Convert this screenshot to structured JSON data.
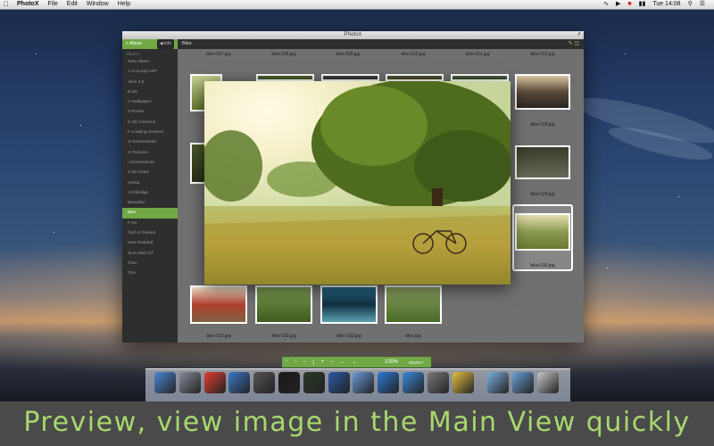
{
  "menubar": {
    "app": "PhotoX",
    "items": [
      "File",
      "Edit",
      "Window",
      "Help"
    ],
    "clock": "Tue 14:08"
  },
  "window": {
    "title": "PhotoX"
  },
  "sidebar": {
    "album_label": "+ Album",
    "info_label": "info",
    "caption": "Albums",
    "items": [
      "New Album",
      "A-Concept ART",
      "Alive 4.0",
      "B-3D",
      "C-Wallpaper",
      "D-Poster",
      "E-3D Columns",
      "F-Loading Screens",
      "G-Screenshots",
      "H-Textures",
      "I-Screenshots",
      "J-3D Chars",
      "Aprilia",
      "Archbridge",
      "Beautiful",
      "Bike",
      "F-16",
      "Golf of Finland",
      "New Zealand",
      "SLS AMG GT",
      "Train",
      "Tyre"
    ],
    "selected": "Bike"
  },
  "main": {
    "breadcrumb": "Bike",
    "top_files": [
      "bike-007.jpg",
      "bike-008.jpg",
      "bike-009.jpg",
      "bike-010.jpg",
      "bike-011.jpg",
      "bike-012.jpg"
    ],
    "right_files": [
      "bike-018.jpg",
      "bike-024.jpg",
      "bike-030.jpg"
    ],
    "bottom_files": [
      "bike-031.jpg",
      "bike-032.jpg",
      "bike-033.jpg",
      "bike.jpg"
    ]
  },
  "controls": {
    "zoom": "100%",
    "count": "824/347"
  },
  "caption": "Preview, view image in the Main View quickly"
}
